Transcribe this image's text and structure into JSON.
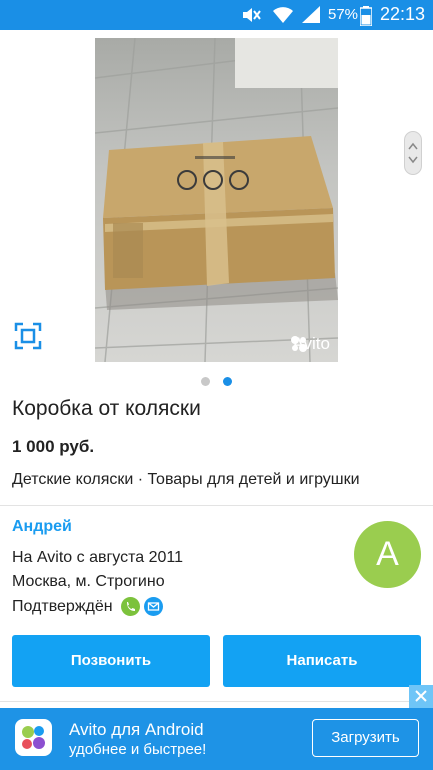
{
  "status_bar": {
    "battery_percent": "57%",
    "time": "22:13",
    "icons": [
      "mute-icon",
      "wifi-icon",
      "signal-icon",
      "battery-icon"
    ]
  },
  "gallery": {
    "watermark": "Avito",
    "image_count": 2,
    "active_index": 1,
    "icons": [
      "fullscreen-icon",
      "scroll-handle-icon",
      "avito-logo-icon"
    ]
  },
  "listing": {
    "title": "Коробка от коляски",
    "price": "1 000 руб.",
    "category": "Детские коляски",
    "separator": "·",
    "parent_category": "Товары для детей и игрушки"
  },
  "seller": {
    "name": "Андрей",
    "since": "На Avito с августа 2011",
    "location": "Москва, м. Строгино",
    "verified_label": "Подтверждён",
    "avatar_letter": "A",
    "avatar_color": "#9acd4f",
    "verified_icons": [
      "phone-verified-icon",
      "email-verified-icon"
    ]
  },
  "actions": {
    "call_label": "Позвонить",
    "message_label": "Написать"
  },
  "app_banner": {
    "title": "Avito для Android",
    "subtitle": "удобнее и быстрее!",
    "download_label": "Загрузить",
    "icons": [
      "avito-app-icon",
      "close-icon"
    ]
  },
  "colors": {
    "accent": "#1a8fe6",
    "button": "#13a2f3",
    "seller_name": "#1a9cf0",
    "banner": "#1e93e6"
  }
}
